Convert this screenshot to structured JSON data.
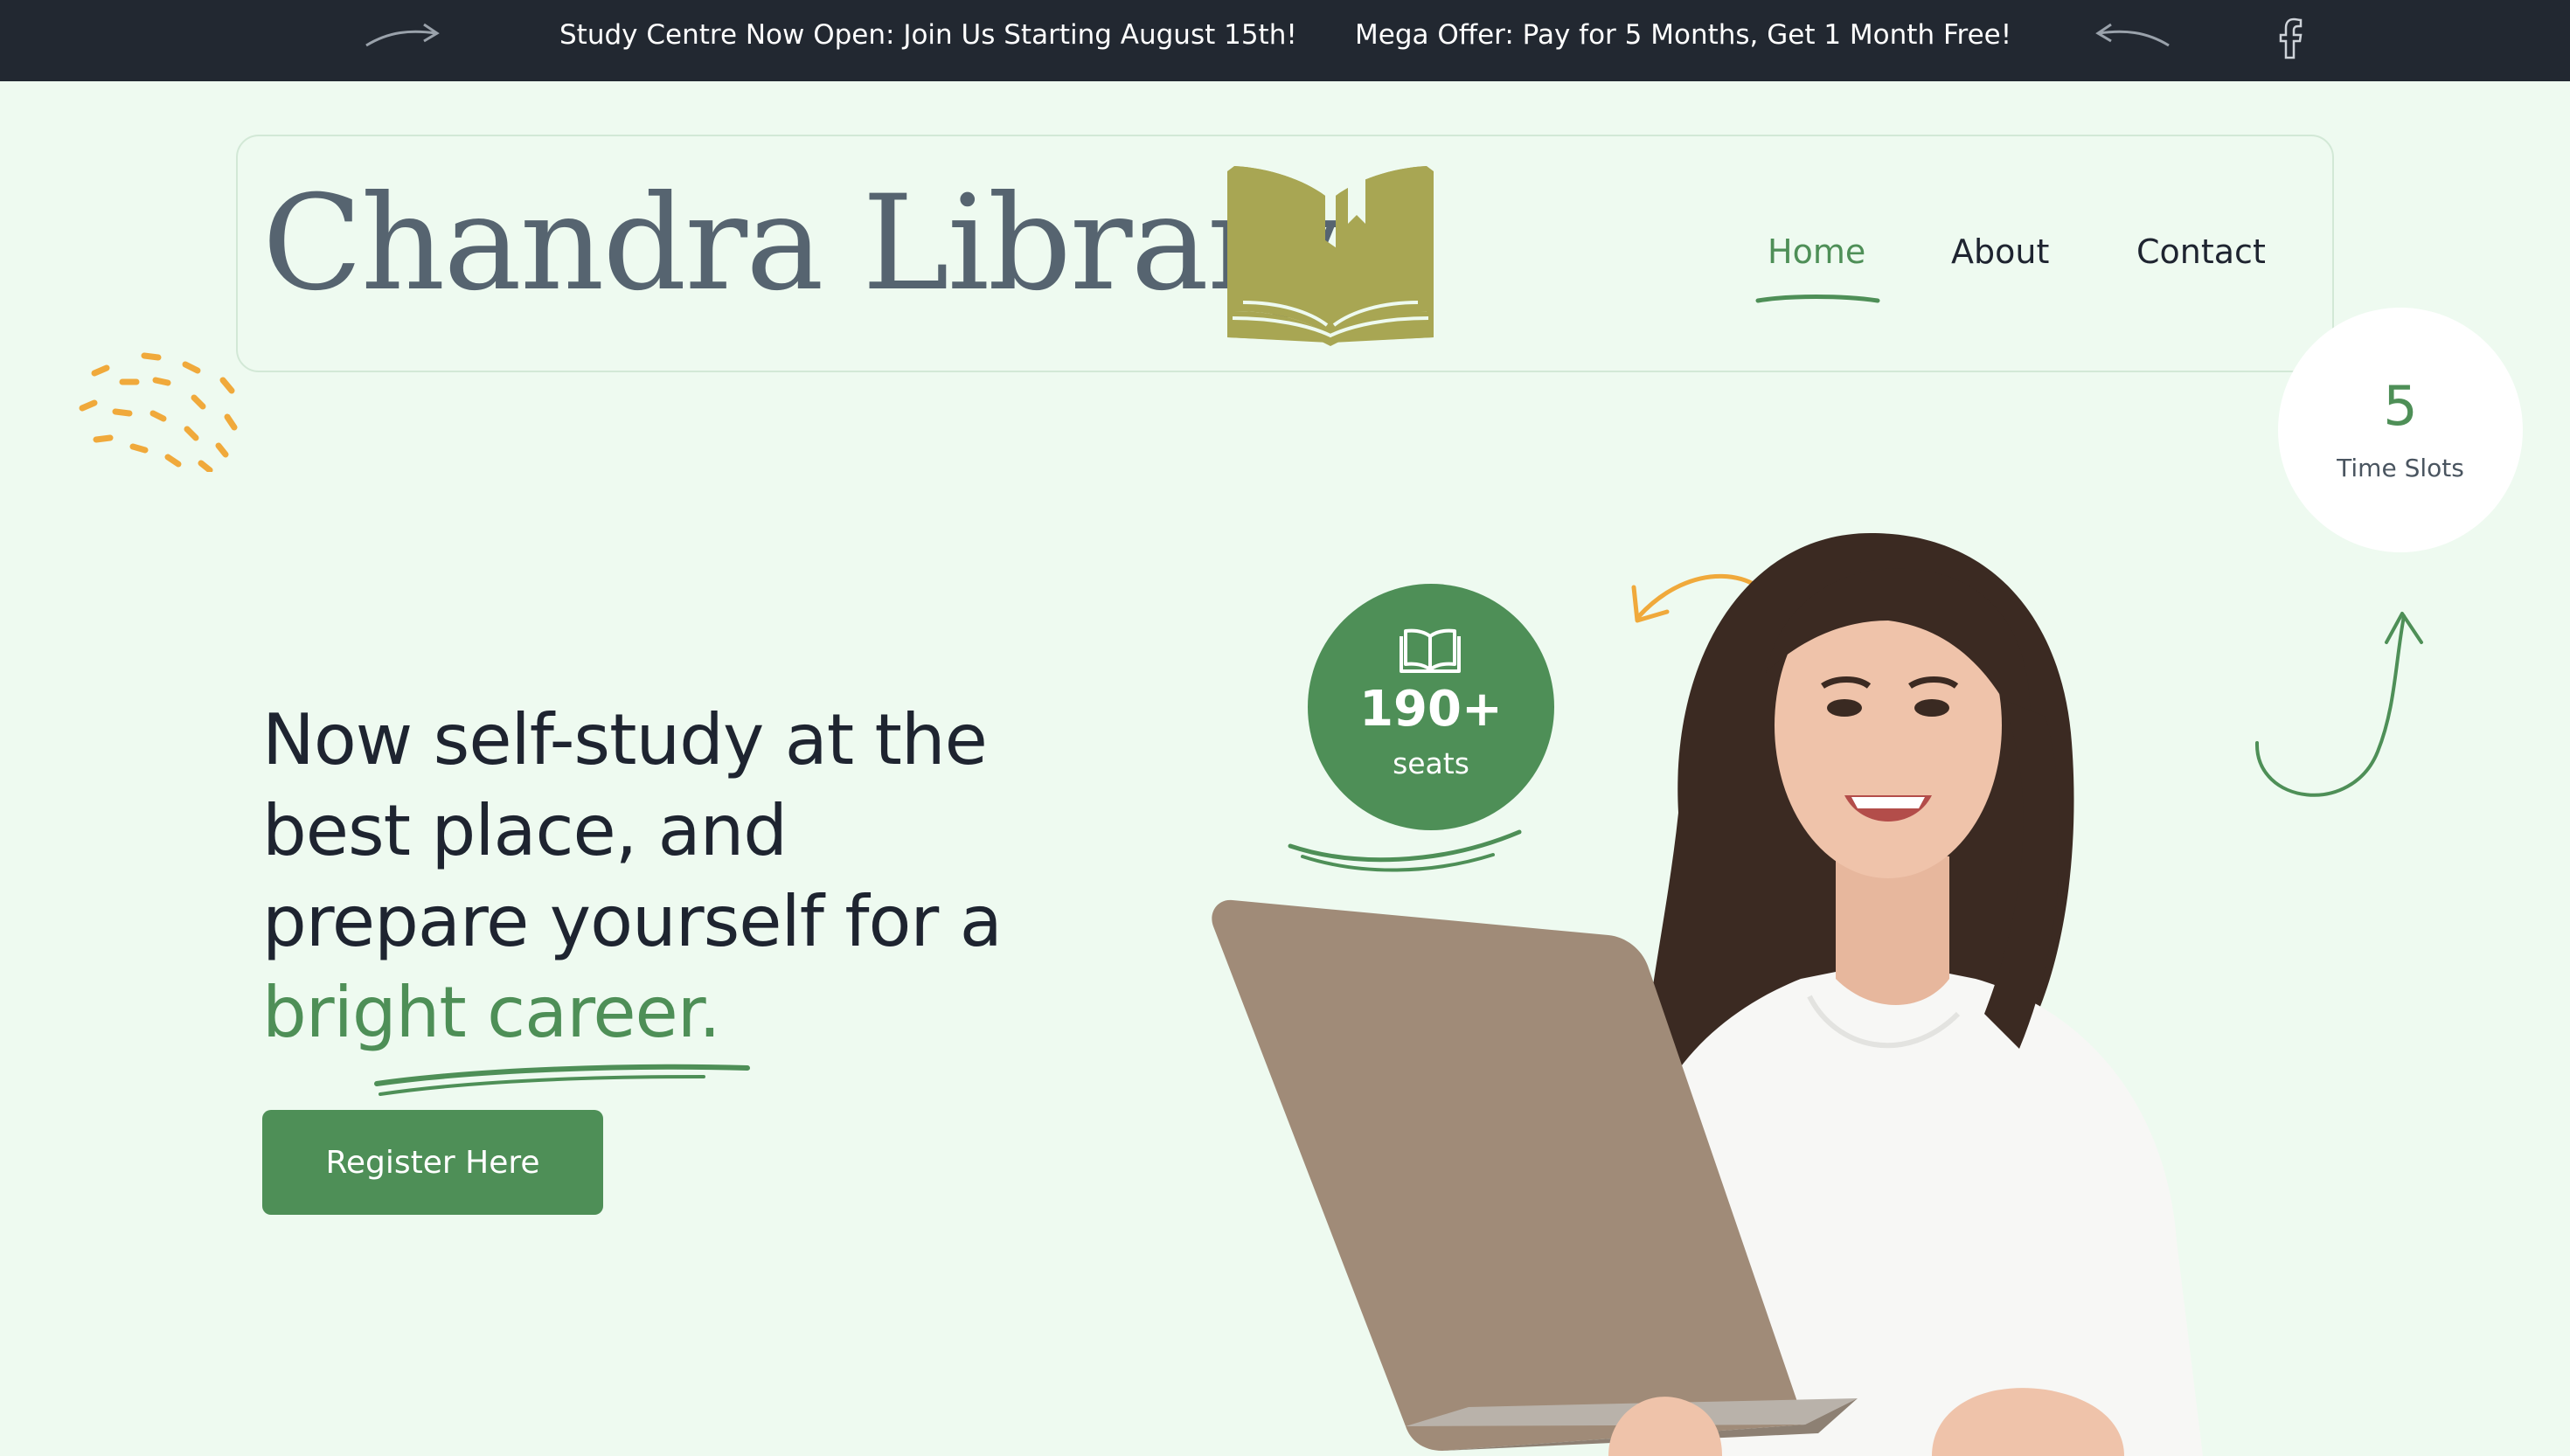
{
  "colors": {
    "topbar_bg": "#222831",
    "page_bg": "#eefaf0",
    "accent_green": "#4e8f57",
    "logo_olive": "#a8a653",
    "decor_orange": "#f0a93b",
    "text_dark": "#1e2430",
    "brand_gray": "#566470"
  },
  "topbar": {
    "announcements": [
      "Study Centre Now Open: Join Us Starting August 15th!",
      "Mega Offer: Pay for 5 Months, Get 1 Month Free!"
    ],
    "icons": [
      "arrow-right-icon",
      "arrow-left-icon",
      "facebook-icon"
    ]
  },
  "header": {
    "brand": "Chandra Library",
    "logo_icon": "open-book-logo-icon",
    "nav": [
      {
        "label": "Home",
        "active": true
      },
      {
        "label": "About",
        "active": false
      },
      {
        "label": "Contact",
        "active": false
      }
    ]
  },
  "stats": {
    "slots": {
      "value": "5",
      "label": "Time Slots"
    },
    "seats": {
      "value": "190+",
      "label": "seats",
      "icon": "open-book-icon"
    }
  },
  "hero": {
    "title_lead": "Now self-study at the best place, and prepare yourself for a ",
    "title_accent": "bright career.",
    "cta_label": "Register Here",
    "image": "woman-with-laptop-photo"
  }
}
